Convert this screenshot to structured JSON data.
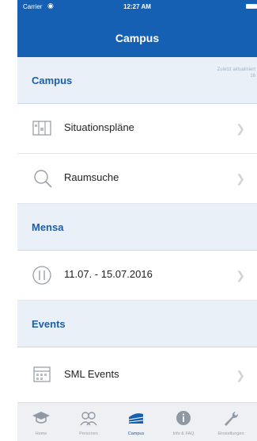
{
  "statusbar": {
    "carrier": "Carrier",
    "time": "12:27 AM"
  },
  "navbar": {
    "title": "Campus"
  },
  "sections": {
    "campus": {
      "title": "Campus",
      "note_line1": "Zuletzt aktualisiert",
      "note_line2": "16"
    },
    "mensa": {
      "title": "Mensa"
    },
    "events": {
      "title": "Events"
    }
  },
  "rows": {
    "situationsplaene": {
      "label": "Situationspläne",
      "icon": "map-icon"
    },
    "raumsuche": {
      "label": "Raumsuche",
      "icon": "search-icon"
    },
    "mensa_week": {
      "label": "11.07. - 15.07.2016",
      "icon": "cutlery-icon"
    },
    "sml_events": {
      "label": "SML Events",
      "icon": "calendar-icon"
    }
  },
  "tabbar": {
    "items": [
      {
        "label": "Home",
        "icon": "graduation-cap-icon"
      },
      {
        "label": "Personen",
        "icon": "people-icon"
      },
      {
        "label": "Campus",
        "icon": "campus-building-icon"
      },
      {
        "label": "Info & FAQ",
        "icon": "info-icon"
      },
      {
        "label": "Einstellungen",
        "icon": "wrench-icon"
      }
    ]
  },
  "colors": {
    "accent": "#1660b3",
    "section_bg": "#e9f0f8",
    "section_text": "#1a5fa8"
  }
}
